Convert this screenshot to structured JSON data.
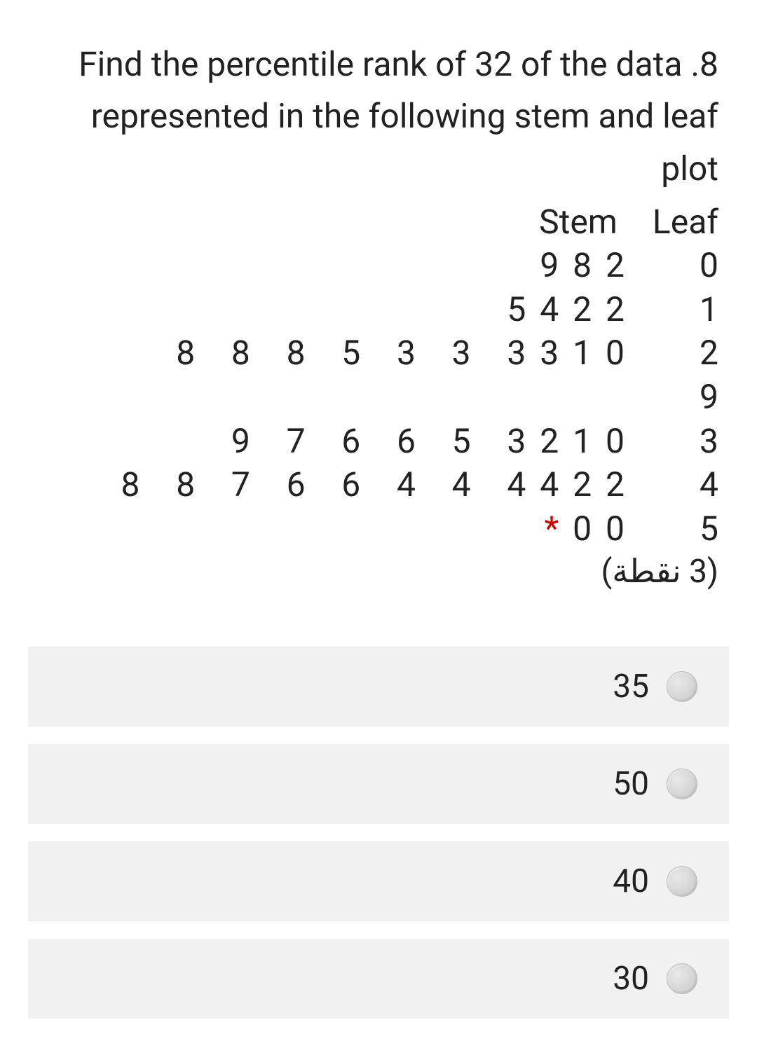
{
  "question": {
    "number_suffix": ".8",
    "line1": "Find the percentile rank of 32 of the data",
    "line2": "represented in the following stem and leaf",
    "line3": "plot"
  },
  "stem_leaf": {
    "header_stem": "Stem",
    "header_leaf": "Leaf",
    "rows": [
      {
        "leaves": "9 8 2",
        "stem": "0"
      },
      {
        "leaves": "5 4 2 2",
        "stem": "1"
      },
      {
        "leaves": "8   8   8   5   3   3   3 3 1 0",
        "stem": "2"
      },
      {
        "leaves": "",
        "stem": "9"
      },
      {
        "leaves": "9   7   6   6   5   3 2 1 0",
        "stem": "3"
      },
      {
        "leaves": "8   8   7   6   6   4   4   4 4 2 2",
        "stem": "4"
      },
      {
        "leaves": "0 0",
        "stem": "5",
        "asterisk": "*"
      }
    ]
  },
  "points_label": "(3 نقطة)",
  "options": [
    {
      "label": "35"
    },
    {
      "label": "50"
    },
    {
      "label": "40"
    },
    {
      "label": "30"
    }
  ]
}
